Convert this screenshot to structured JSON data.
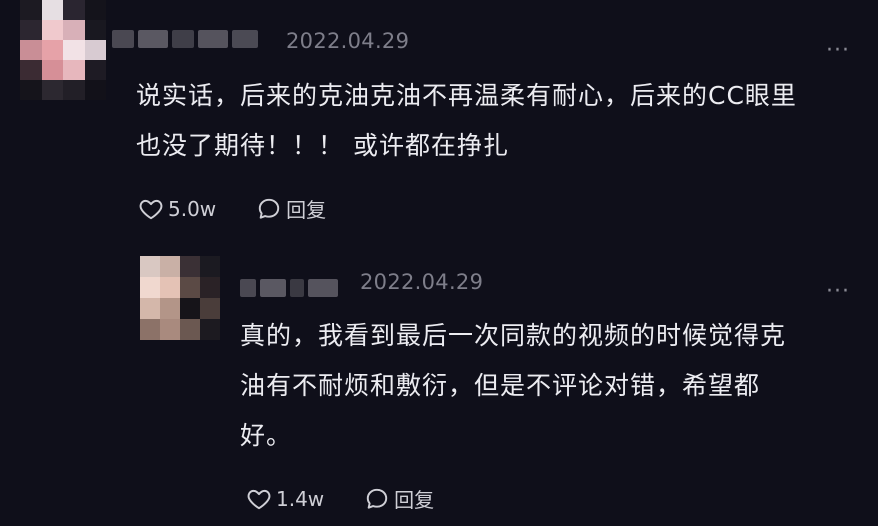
{
  "comments": [
    {
      "date": "2022.04.29",
      "more": "···",
      "text_line1": "说实话，后来的克油克油不再温柔有耐心，后来的CC眼里",
      "text_line2": "也没了期待！！！ 或许都在挣扎",
      "likes": "5.0w",
      "reply_label": "回复"
    },
    {
      "date": "2022.04.29",
      "more": "···",
      "text_line1": "真的，我看到最后一次同款的视频的时候觉得克",
      "text_line2": "油有不耐烦和敷衍，但是不评论对错，希望都",
      "text_line3": "好。",
      "likes": "1.4w",
      "reply_label": "回复"
    }
  ],
  "icons": {
    "like": "heart-icon",
    "reply": "comment-bubble-icon",
    "more": "more-dots-icon"
  },
  "colors": {
    "background": "#0f0f1a",
    "text": "#ececf1",
    "meta": "#7e7e8a"
  }
}
